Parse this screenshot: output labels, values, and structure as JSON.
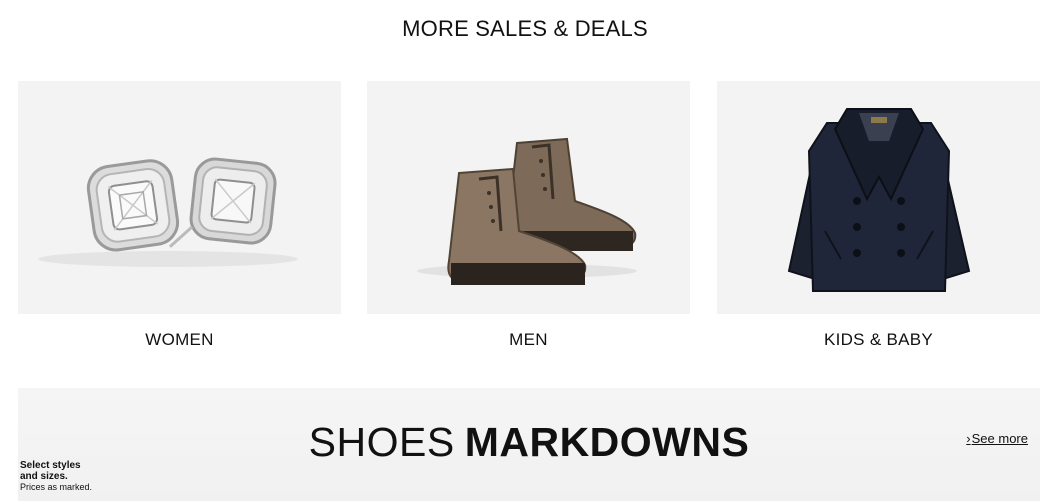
{
  "section": {
    "title": "MORE SALES & DEALS"
  },
  "cards": [
    {
      "label": "WOMEN",
      "image": "diamond-halo-earrings"
    },
    {
      "label": "MEN",
      "image": "brown-wingtip-boots"
    },
    {
      "label": "KIDS & BABY",
      "image": "navy-peacoat"
    }
  ],
  "banner": {
    "title_light": "SHOES",
    "title_bold": "MARKDOWNS",
    "see_more": "See more",
    "fine_print_strong": "Select styles and sizes.",
    "fine_print_small": "Prices as marked."
  },
  "colors": {
    "card_bg": "#f3f3f3",
    "banner_bg": "#f3f3f3",
    "text": "#111111"
  }
}
